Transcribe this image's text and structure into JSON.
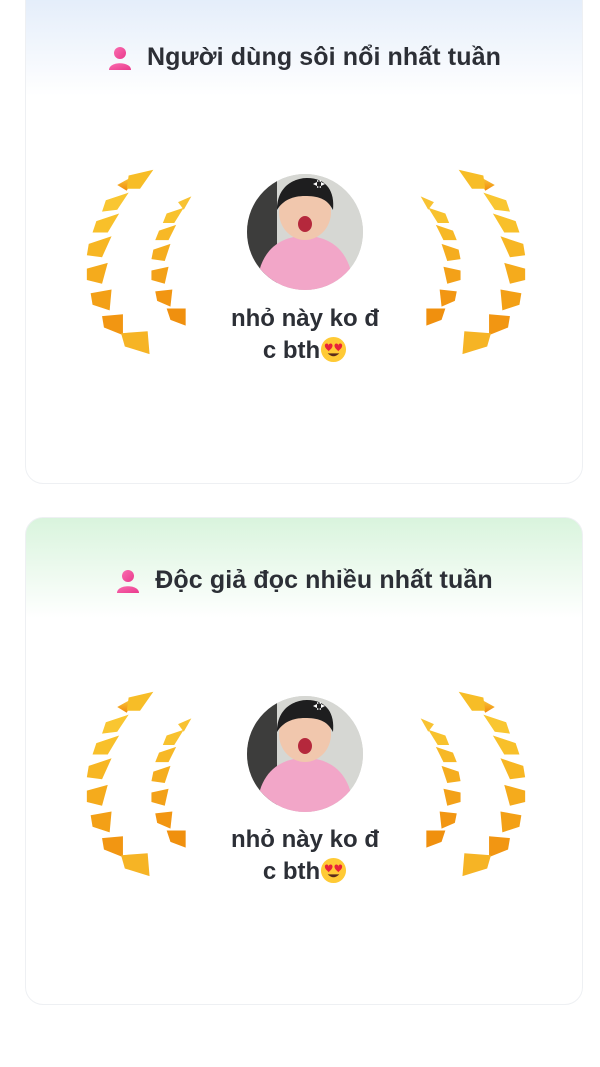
{
  "sections": [
    {
      "title": "Người dùng sôi nổi nhất tuần",
      "icon": "user-icon",
      "user": {
        "name": "nhỏ này ko đ\nc bth",
        "name_emoji": "heart-eyes-emoji",
        "avatar": "user-avatar"
      },
      "header_color": "#dfeaf9"
    },
    {
      "title": "Độc giả đọc nhiều nhất tuần",
      "icon": "user-icon",
      "user": {
        "name": "nhỏ này ko đ\nc bth",
        "name_emoji": "heart-eyes-emoji",
        "avatar": "user-avatar"
      },
      "header_color": "#d9f4dd"
    }
  ],
  "colors": {
    "title_text": "#2c2f36",
    "icon_pink": "#f0479a",
    "laurel_gold": "#f6b21c",
    "laurel_orange": "#f08a0c"
  }
}
